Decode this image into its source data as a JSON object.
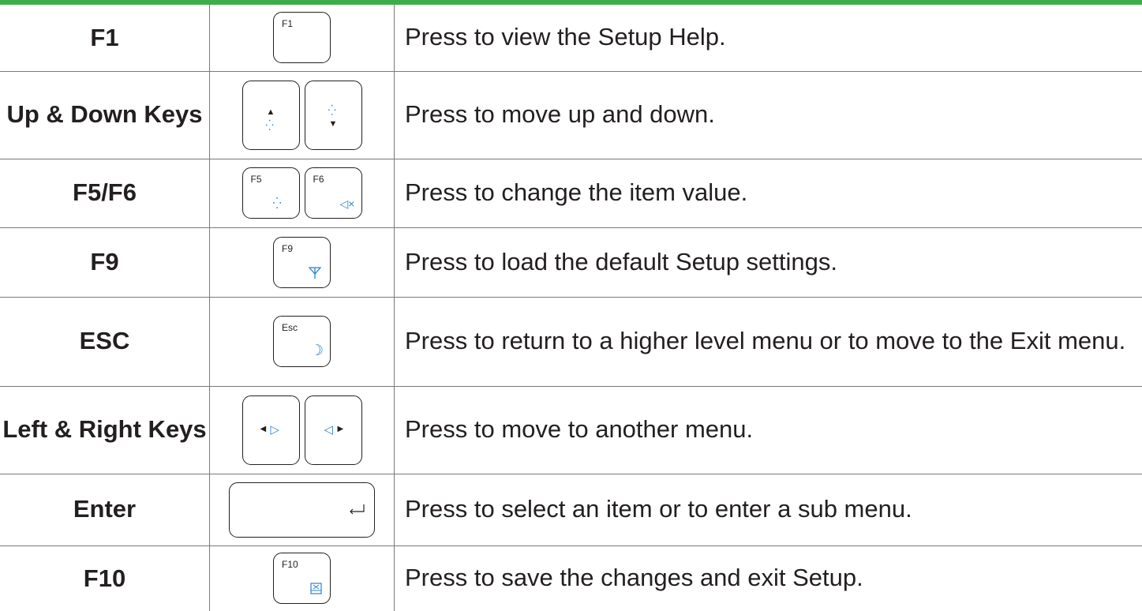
{
  "rows": [
    {
      "name": "F1",
      "keys": [
        {
          "label": "F1",
          "icon": ""
        }
      ],
      "description": "Press to view the Setup Help."
    },
    {
      "name": "Up & Down Keys",
      "keys": [
        {
          "label": "",
          "icon": "arrow-up-brightness-icon"
        },
        {
          "label": "",
          "icon": "brightness-arrow-down-icon"
        }
      ],
      "description": "Press to move up and down."
    },
    {
      "name": "F5/F6",
      "keys": [
        {
          "label": "F5",
          "icon": "brightness-icon"
        },
        {
          "label": "F6",
          "icon": "mute-icon"
        }
      ],
      "description": "Press to change the item value."
    },
    {
      "name": "F9",
      "keys": [
        {
          "label": "F9",
          "icon": "wireless-antenna-icon"
        }
      ],
      "description": "Press to load the default Setup settings."
    },
    {
      "name": "ESC",
      "keys": [
        {
          "label": "Esc",
          "icon": "sleep-moon-icon"
        }
      ],
      "description": "Press to return to a higher level menu or to move to the Exit menu."
    },
    {
      "name": "Left & Right Keys",
      "keys": [
        {
          "label": "",
          "icon": "arrow-left-volume-down-icon"
        },
        {
          "label": "",
          "icon": "volume-up-arrow-right-icon"
        }
      ],
      "description": "Press to move to another menu."
    },
    {
      "name": "Enter",
      "keys": [
        {
          "label": "",
          "icon": "enter-return-icon"
        }
      ],
      "description": "Press to select an item or to enter a sub menu."
    },
    {
      "name": "F10",
      "keys": [
        {
          "label": "F10",
          "icon": "touchpad-icon"
        }
      ],
      "description": "Press to save the changes and exit Setup."
    }
  ],
  "colors": {
    "accent": "#3cad49",
    "icon": "#2a84d2",
    "text": "#231f20",
    "rule": "#7a7a7a"
  }
}
